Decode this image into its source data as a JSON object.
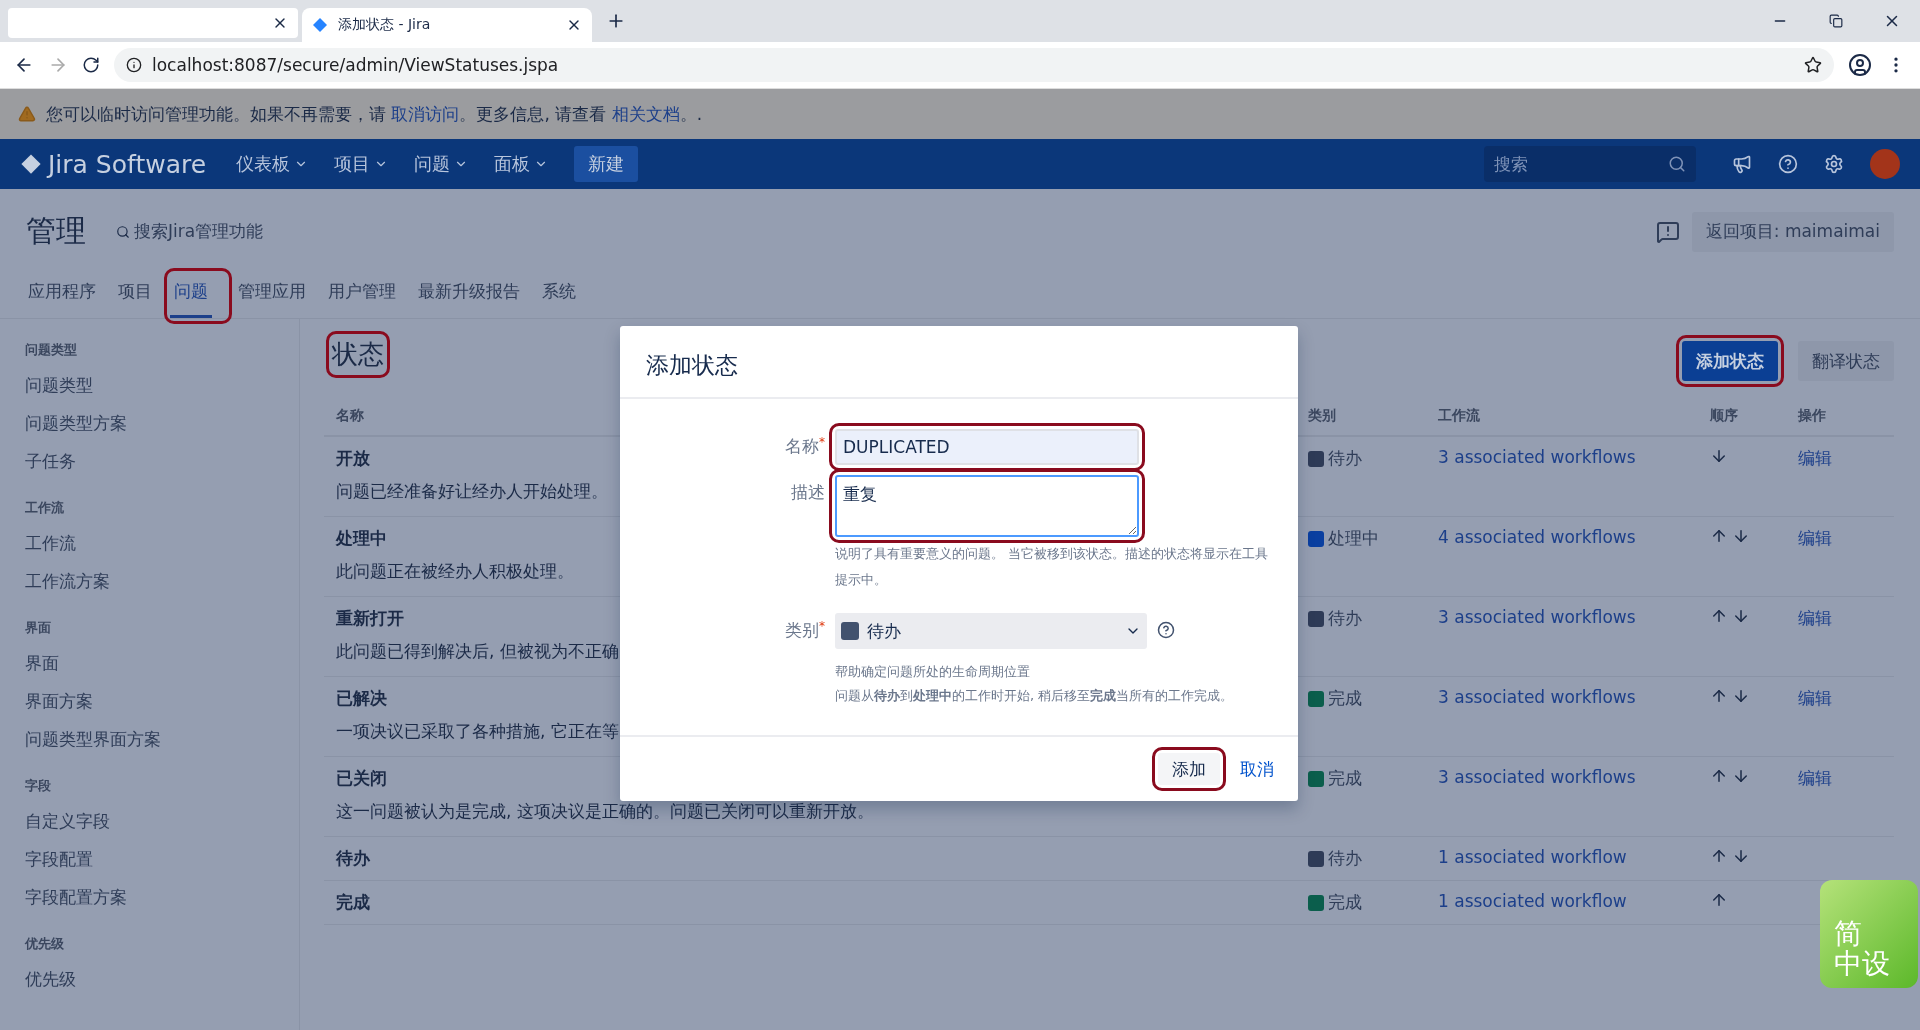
{
  "browser": {
    "tabs": [
      {
        "selected": false
      },
      {
        "title": "添加状态 - Jira",
        "selected": true
      }
    ],
    "address": "localhost:8087/secure/admin/ViewStatuses.jspa"
  },
  "banner": [
    {
      "kind": "text",
      "text": "您可以临时访问管理功能。如果不再需要，请 "
    },
    {
      "kind": "link",
      "text": "取消访问"
    },
    {
      "kind": "text",
      "text": "。更多信息, 请查看 "
    },
    {
      "kind": "link",
      "text": "相关文档"
    },
    {
      "kind": "text",
      "text": "。."
    }
  ],
  "nav": {
    "logo": "Jira Software",
    "menus": [
      "仪表板",
      "项目",
      "问题",
      "面板"
    ],
    "create": "新建",
    "search_placeholder": "搜索"
  },
  "admin": {
    "title": "管理",
    "search": "搜索Jira管理功能",
    "back": "返回项目: maimaimai",
    "tabs": [
      {
        "label": "应用程序",
        "selected": false
      },
      {
        "label": "项目",
        "selected": false
      },
      {
        "label": "问题",
        "selected": true,
        "annotated": true
      },
      {
        "label": "管理应用",
        "selected": false
      },
      {
        "label": "用户管理",
        "selected": false
      },
      {
        "label": "最新升级报告",
        "selected": false
      },
      {
        "label": "系统",
        "selected": false
      }
    ]
  },
  "sidebar": [
    {
      "heading": "问题类型",
      "items": [
        "问题类型",
        "问题类型方案",
        "子任务"
      ]
    },
    {
      "heading": "工作流",
      "items": [
        "工作流",
        "工作流方案"
      ]
    },
    {
      "heading": "界面",
      "items": [
        "界面",
        "界面方案",
        "问题类型界面方案"
      ]
    },
    {
      "heading": "字段",
      "items": [
        "自定义字段",
        "字段配置",
        "字段配置方案"
      ]
    },
    {
      "heading": "优先级",
      "items": [
        "优先级"
      ]
    }
  ],
  "content": {
    "title": "状态",
    "title_annotated": true,
    "buttons": [
      {
        "label": "添加状态",
        "kind": "primary",
        "annotated": true
      },
      {
        "label": "翻译状态",
        "kind": "default"
      }
    ],
    "columns": [
      "名称",
      "类别",
      "工作流",
      "顺序",
      "操作"
    ],
    "rows": [
      {
        "name": "开放",
        "description": "问题已经准备好让经办人开始处理。",
        "category": "待办",
        "color": "#2e3b57",
        "workflows": "3 associated workflows",
        "up": false,
        "down": true,
        "edit": "编辑"
      },
      {
        "name": "处理中",
        "description": "此问题正在被经办人积极处理。",
        "category": "处理中",
        "color": "#0a3fa0",
        "workflows": "4 associated workflows",
        "up": true,
        "down": true,
        "edit": "编辑"
      },
      {
        "name": "重新打开",
        "description": "此问题已得到解决后, 但被视为不正确",
        "category": "待办",
        "color": "#2e3b57",
        "workflows": "3 associated workflows",
        "up": true,
        "down": true,
        "edit": "编辑"
      },
      {
        "name": "已解决",
        "description": "一项决议已采取了各种措施, 它正在等",
        "category": "完成",
        "color": "#0b5e4c",
        "workflows": "3 associated workflows",
        "up": true,
        "down": true,
        "edit": "编辑"
      },
      {
        "name": "已关闭",
        "description": "这一问题被认为是完成, 这项决议是正确的。问题已关闭可以重新开放。",
        "category": "完成",
        "color": "#0b5e4c",
        "workflows": "3 associated workflows",
        "up": true,
        "down": true,
        "edit": "编辑"
      },
      {
        "name": "待办",
        "category": "待办",
        "color": "#2e3b57",
        "workflows": "1 associated workflow",
        "up": true,
        "down": true
      },
      {
        "name": "完成",
        "category": "完成",
        "color": "#0b5e4c",
        "workflows": "1 associated workflow",
        "up": true,
        "down": false
      }
    ]
  },
  "dialog": {
    "title": "添加状态",
    "name": {
      "label": "名称",
      "required_mark": "*",
      "value": "DUPLICATED",
      "annotated": true
    },
    "description": {
      "label": "描述",
      "value": "重复",
      "annotated": true
    },
    "description_hint": "说明了具有重要意义的问题。 当它被移到该状态。描述的状态将显示在工具提示中。",
    "category": {
      "label": "类别",
      "required_mark": "*",
      "value": "待办",
      "color": "#42526e"
    },
    "category_help": [
      "帮助确定问题所处的生命周期位置",
      "问题从**待办**到**处理中**的工作时开始, 稍后移至**完成**当所有的工作完成。"
    ],
    "submit": {
      "label": "添加",
      "annotated": true
    },
    "cancel": "取消"
  },
  "ime_badge": [
    "简",
    "中设"
  ]
}
